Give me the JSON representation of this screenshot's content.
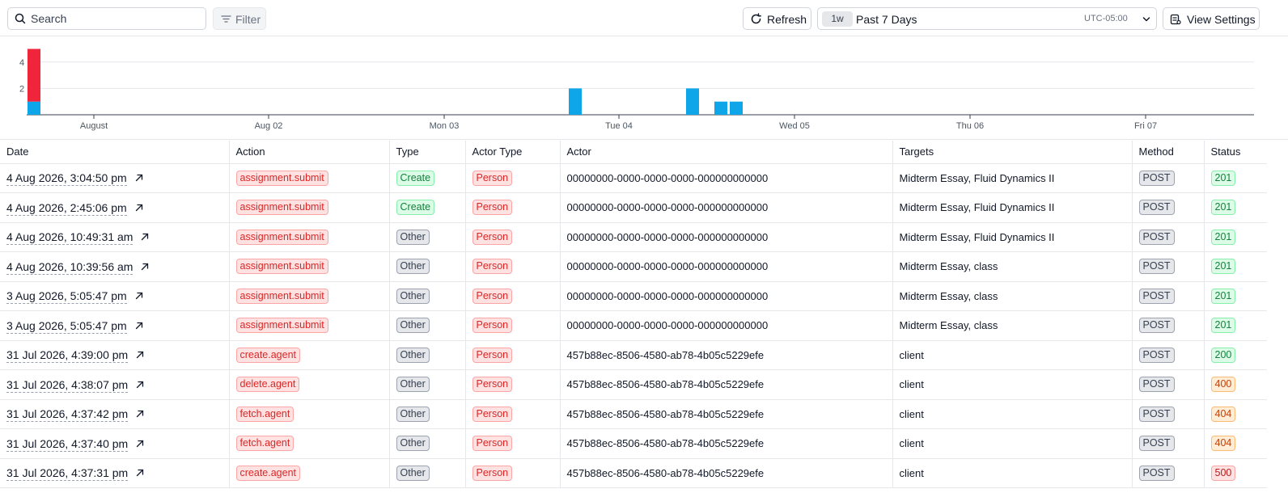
{
  "toolbar": {
    "search_placeholder": "Search",
    "filter_label": "Filter",
    "refresh_label": "Refresh",
    "range_chip": "1w",
    "range_label": "Past 7 Days",
    "timezone": "UTC-05:00",
    "view_settings_label": "View Settings"
  },
  "colors": {
    "error_bar": "#f0243a",
    "success_bar": "#0ea5e9"
  },
  "chart_data": {
    "type": "bar",
    "stacked": true,
    "y_ticks": [
      "2",
      "4"
    ],
    "x_ticks": [
      "August",
      "Aug 02",
      "Mon 03",
      "Tue 04",
      "Wed 05",
      "Thu 06",
      "Fri 07"
    ],
    "ylim": [
      0,
      5
    ],
    "series": [
      {
        "color_key": "success_bar",
        "values": [
          1,
          2,
          2,
          1,
          1
        ]
      },
      {
        "color_key": "error_bar",
        "values": [
          4,
          0,
          0,
          0,
          0
        ]
      }
    ],
    "bar_times": [
      "Jul 31 ~16:30",
      "Aug 04 ~10:40",
      "Aug 04 ~17:00",
      "Aug 04 ~21:00",
      "Aug 04 ~23:00"
    ],
    "grid": true
  },
  "table": {
    "columns": [
      "Date",
      "Action",
      "Type",
      "Actor Type",
      "Actor",
      "Targets",
      "Method",
      "Status"
    ],
    "rows": [
      {
        "date": "4 Aug 2026, 3:04:50 pm",
        "action": "assignment.submit",
        "type": "Create",
        "actor_type": "Person",
        "actor": "00000000-0000-0000-0000-000000000000",
        "targets": "Midterm Essay, Fluid Dynamics II",
        "method": "POST",
        "status": "201"
      },
      {
        "date": "4 Aug 2026, 2:45:06 pm",
        "action": "assignment.submit",
        "type": "Create",
        "actor_type": "Person",
        "actor": "00000000-0000-0000-0000-000000000000",
        "targets": "Midterm Essay, Fluid Dynamics II",
        "method": "POST",
        "status": "201"
      },
      {
        "date": "4 Aug 2026, 10:49:31 am",
        "action": "assignment.submit",
        "type": "Other",
        "actor_type": "Person",
        "actor": "00000000-0000-0000-0000-000000000000",
        "targets": "Midterm Essay, Fluid Dynamics II",
        "method": "POST",
        "status": "201"
      },
      {
        "date": "4 Aug 2026, 10:39:56 am",
        "action": "assignment.submit",
        "type": "Other",
        "actor_type": "Person",
        "actor": "00000000-0000-0000-0000-000000000000",
        "targets": "Midterm Essay, class",
        "method": "POST",
        "status": "201"
      },
      {
        "date": "3 Aug 2026, 5:05:47 pm",
        "action": "assignment.submit",
        "type": "Other",
        "actor_type": "Person",
        "actor": "00000000-0000-0000-0000-000000000000",
        "targets": "Midterm Essay, class",
        "method": "POST",
        "status": "201"
      },
      {
        "date": "3 Aug 2026, 5:05:47 pm",
        "action": "assignment.submit",
        "type": "Other",
        "actor_type": "Person",
        "actor": "00000000-0000-0000-0000-000000000000",
        "targets": "Midterm Essay, class",
        "method": "POST",
        "status": "201"
      },
      {
        "date": "31 Jul 2026, 4:39:00 pm",
        "action": "create.agent",
        "type": "Other",
        "actor_type": "Person",
        "actor": "457b88ec-8506-4580-ab78-4b05c5229efe",
        "targets": "client",
        "method": "POST",
        "status": "200"
      },
      {
        "date": "31 Jul 2026, 4:38:07 pm",
        "action": "delete.agent",
        "type": "Other",
        "actor_type": "Person",
        "actor": "457b88ec-8506-4580-ab78-4b05c5229efe",
        "targets": "client",
        "method": "POST",
        "status": "400"
      },
      {
        "date": "31 Jul 2026, 4:37:42 pm",
        "action": "fetch.agent",
        "type": "Other",
        "actor_type": "Person",
        "actor": "457b88ec-8506-4580-ab78-4b05c5229efe",
        "targets": "client",
        "method": "POST",
        "status": "404"
      },
      {
        "date": "31 Jul 2026, 4:37:40 pm",
        "action": "fetch.agent",
        "type": "Other",
        "actor_type": "Person",
        "actor": "457b88ec-8506-4580-ab78-4b05c5229efe",
        "targets": "client",
        "method": "POST",
        "status": "404"
      },
      {
        "date": "31 Jul 2026, 4:37:31 pm",
        "action": "create.agent",
        "type": "Other",
        "actor_type": "Person",
        "actor": "457b88ec-8506-4580-ab78-4b05c5229efe",
        "targets": "client",
        "method": "POST",
        "status": "500"
      }
    ]
  }
}
